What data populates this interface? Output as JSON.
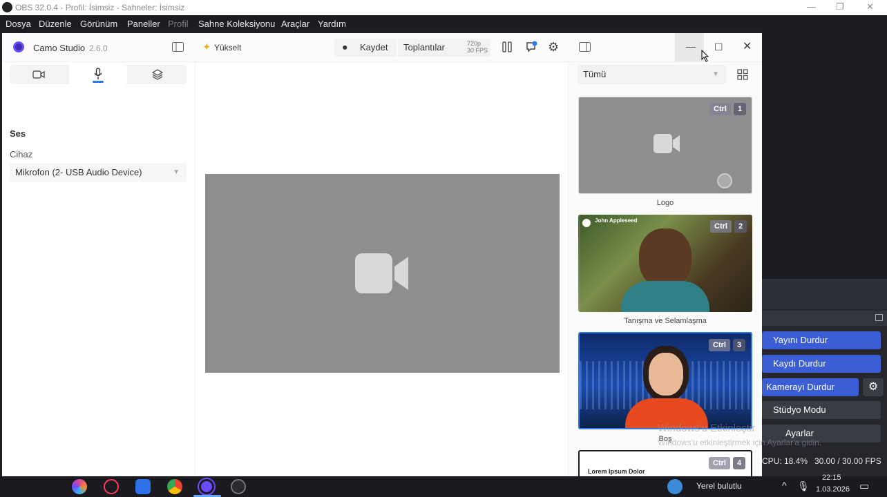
{
  "obs": {
    "window_title": "OBS 32.0.4 - Profil: İsimsiz - Sahneler: İsimsiz",
    "menu": [
      "Dosya",
      "Düzenle",
      "Görünüm",
      "Paneller",
      "Profil",
      "Sahne Koleksiyonu",
      "Araçlar",
      "Yardım"
    ],
    "controls": {
      "stop_stream": "Yayını Durdur",
      "stop_record": "Kaydı Durdur",
      "stop_camera": "Kamerayı Durdur",
      "studio_mode": "Stüdyo Modu",
      "settings": "Ayarlar"
    },
    "status": {
      "cpu": "CPU: 18.4%",
      "fps": "30.00 / 30.00 FPS"
    }
  },
  "camo": {
    "app_name": "Camo Studio",
    "version": "2.6.0",
    "upgrade_label": "Yükselt",
    "record_label": "Kaydet",
    "meetings_label": "Toplantılar",
    "resolution": "720p",
    "framerate": "30 FPS",
    "audio": {
      "section_title": "Ses",
      "device_label": "Cihaz",
      "device_value": "Mikrofon (2- USB Audio Device)"
    },
    "filter_value": "Tümü",
    "scenes": [
      {
        "shortcut": "Ctrl",
        "number": "1",
        "label": "Logo"
      },
      {
        "shortcut": "Ctrl",
        "number": "2",
        "label": "Tanışma ve Selamlaşma",
        "card_name": "John Appleseed"
      },
      {
        "shortcut": "Ctrl",
        "number": "3",
        "label": "Boş"
      },
      {
        "shortcut": "Ctrl",
        "number": "4",
        "label": "",
        "card_title": "Lorem Ipsum Dolor"
      }
    ]
  },
  "watermark": {
    "line1": "Windows'u Etkinleştir",
    "line2": "Windows'u etkinleştirmek için Ayarlar'a gidin."
  },
  "taskbar": {
    "notification_text": "Yerel bulutlu",
    "time": "22:15",
    "date": "1.03.2026"
  }
}
